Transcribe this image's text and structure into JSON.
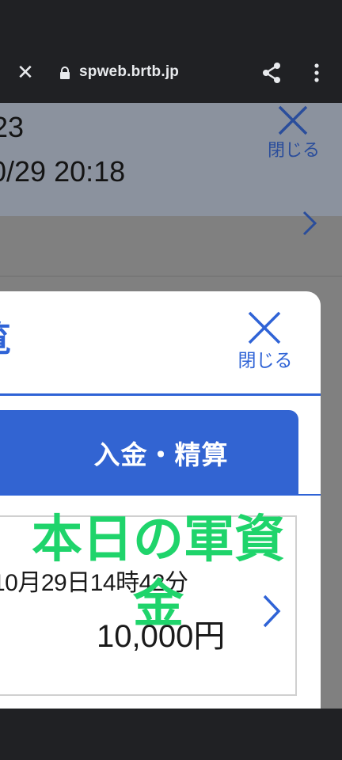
{
  "browser": {
    "url": "spweb.brtb.jp",
    "icons": {
      "close": "close-icon",
      "lock": "lock-icon",
      "share": "share-icon",
      "menu": "more-vert-icon"
    }
  },
  "underlying_page": {
    "line1": "23",
    "line2": "0/29 20:18",
    "close_label": "閉じる"
  },
  "modal": {
    "title": "覧",
    "close_label": "閉じる",
    "tab_label": "入金・精算",
    "accent_color": "#3264d2",
    "items": [
      {
        "datetime": "10月29日14時42分",
        "amount": "10,000円"
      }
    ]
  },
  "overlay_caption": "本日の軍資金"
}
